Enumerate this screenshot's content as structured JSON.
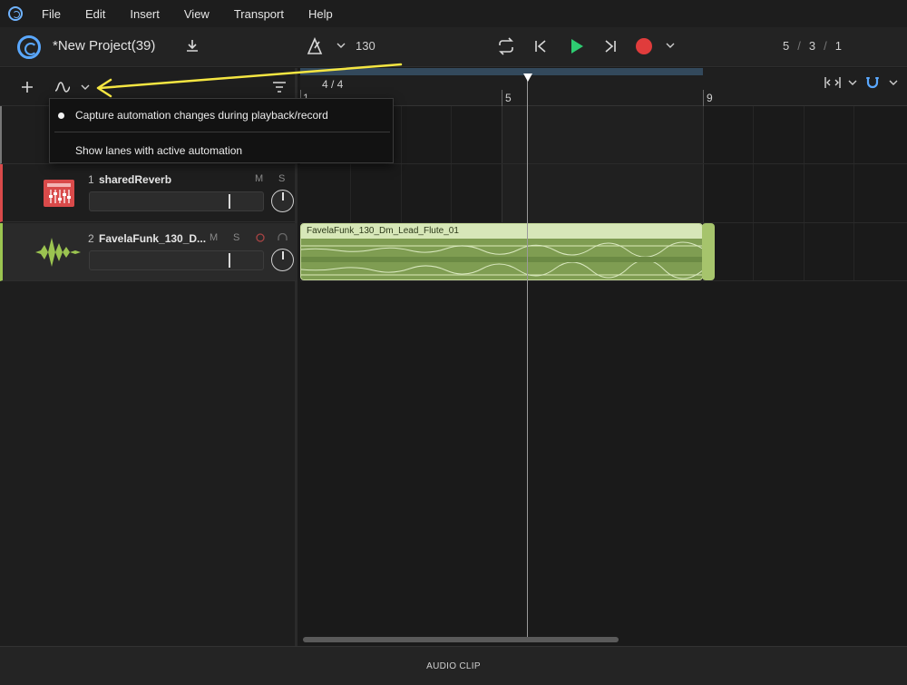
{
  "menu": {
    "items": [
      "File",
      "Edit",
      "Insert",
      "View",
      "Transport",
      "Help"
    ]
  },
  "topbar": {
    "project_title": "*New Project(39)",
    "tempo": "130",
    "position": {
      "bar": "5",
      "beat": "3",
      "tick": "1",
      "separator": "/"
    }
  },
  "ruler": {
    "time_signature": "4 / 4",
    "bars": [
      "1",
      "5",
      "9"
    ]
  },
  "popup": {
    "item1": "Capture automation changes during playback/record",
    "item2": "Show lanes with active automation"
  },
  "tracks": [
    {
      "number": "1",
      "name": "sharedReverb",
      "mute": "M",
      "solo": "S",
      "color": "#d94a4a"
    },
    {
      "number": "2",
      "name": "FavelaFunk_130_D...",
      "mute": "M",
      "solo": "S",
      "color": "#9bc450"
    }
  ],
  "clip": {
    "title": "FavelaFunk_130_Dm_Lead_Flute_01"
  },
  "bottom": {
    "label": "AUDIO CLIP"
  },
  "colors": {
    "accent": "#5aa8ff",
    "play": "#2ecc71",
    "record": "#e03c3c",
    "clip": "#88a85c",
    "annotation": "#f5e642"
  }
}
